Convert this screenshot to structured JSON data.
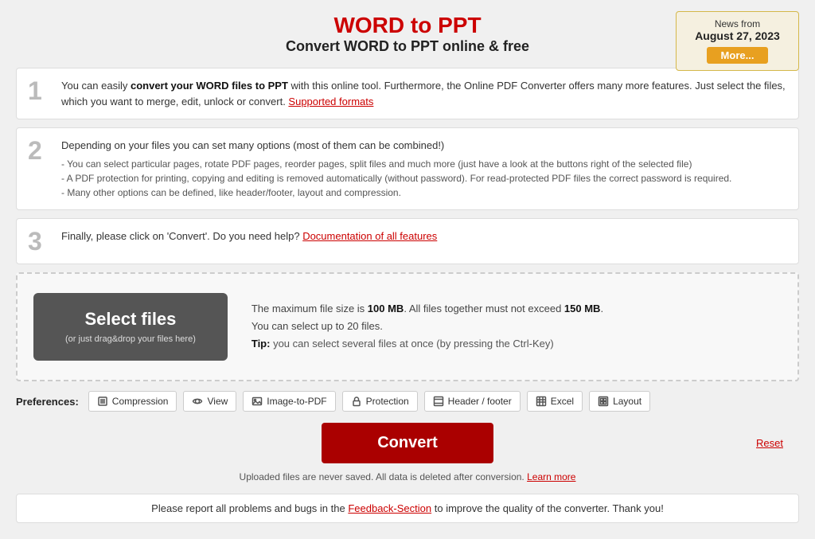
{
  "header": {
    "title": "WORD to PPT",
    "subtitle": "Convert WORD to PPT online & free"
  },
  "news_box": {
    "title": "News from",
    "date": "August 27, 2023",
    "more_label": "More..."
  },
  "steps": [
    {
      "number": "1",
      "text_before": "You can easily ",
      "text_bold": "convert your WORD files to PPT",
      "text_after": " with this online tool. Furthermore, the Online PDF Converter offers many more features. Just select the files, which you want to merge, edit, unlock or convert.",
      "link_text": "Supported formats",
      "small_lines": []
    },
    {
      "number": "2",
      "main_text": "Depending on your files you can set many options (most of them can be combined!)",
      "small_lines": [
        "- You can select particular pages, rotate PDF pages, reorder pages, split files and much more (just have a look at the buttons right of the selected file)",
        "- A PDF protection for printing, copying and editing is removed automatically (without password). For read-protected PDF files the correct password is required.",
        "- Many other options can be defined, like header/footer, layout and compression."
      ]
    },
    {
      "number": "3",
      "text_before": "Finally, please click on 'Convert'. Do you need help?",
      "link_text": "Documentation of all features"
    }
  ],
  "upload": {
    "select_label": "Select files",
    "drag_label": "(or just drag&drop your files here)",
    "info_line1_before": "The maximum file size is ",
    "info_line1_bold1": "100 MB",
    "info_line1_mid": ". All files together must not exceed ",
    "info_line1_bold2": "150 MB",
    "info_line1_end": ".",
    "info_line2": "You can select up to 20 files.",
    "tip_text": "Tip: you can select several files at once (by pressing the Ctrl-Key)"
  },
  "preferences": {
    "label": "Preferences:",
    "buttons": [
      {
        "id": "compression",
        "label": "Compression",
        "icon": "compression"
      },
      {
        "id": "view",
        "label": "View",
        "icon": "view"
      },
      {
        "id": "image-to-pdf",
        "label": "Image-to-PDF",
        "icon": "image"
      },
      {
        "id": "protection",
        "label": "Protection",
        "icon": "lock"
      },
      {
        "id": "header-footer",
        "label": "Header / footer",
        "icon": "header"
      },
      {
        "id": "excel",
        "label": "Excel",
        "icon": "excel"
      },
      {
        "id": "layout",
        "label": "Layout",
        "icon": "layout"
      }
    ]
  },
  "convert": {
    "button_label": "Convert",
    "reset_label": "Reset"
  },
  "privacy": {
    "text": "Uploaded files are never saved. All data is deleted after conversion.",
    "learn_more": "Learn more"
  },
  "feedback": {
    "text_before": "Please report all problems and bugs in the ",
    "link_text": "Feedback-Section",
    "text_after": " to improve the quality of the converter. Thank you!"
  }
}
